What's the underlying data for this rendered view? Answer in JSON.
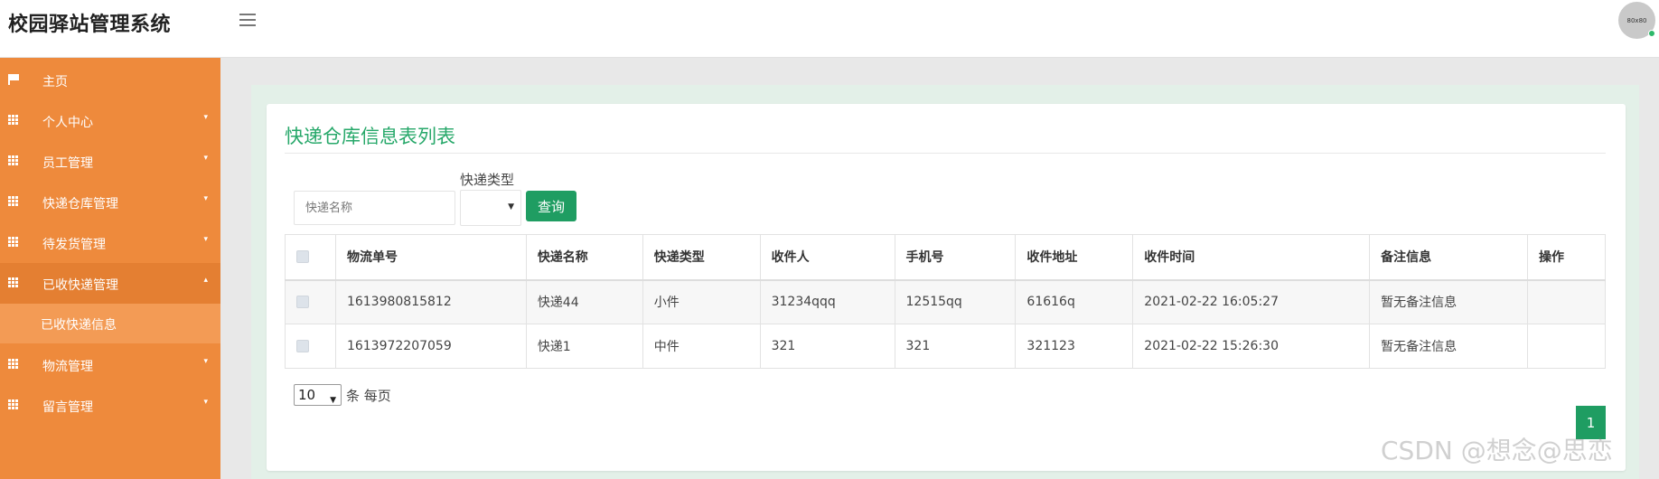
{
  "app": {
    "title": "校园驿站管理系统",
    "avatar_text": "80x80"
  },
  "sidebar": {
    "items": [
      {
        "label": "主页",
        "icon": "flag-icon"
      },
      {
        "label": "个人中心",
        "icon": "grid-icon"
      },
      {
        "label": "员工管理",
        "icon": "grid-icon"
      },
      {
        "label": "快递仓库管理",
        "icon": "grid-icon"
      },
      {
        "label": "待发货管理",
        "icon": "grid-icon"
      },
      {
        "label": "已收快递管理",
        "icon": "grid-icon"
      },
      {
        "label": "物流管理",
        "icon": "grid-icon"
      },
      {
        "label": "留言管理",
        "icon": "grid-icon"
      }
    ],
    "sub_item": "已收快递信息"
  },
  "panel": {
    "title": "快递仓库信息表列表"
  },
  "filters": {
    "name_placeholder": "快递名称",
    "type_label": "快递类型",
    "type_value": "",
    "query_label": "查询"
  },
  "table": {
    "columns": [
      "",
      "物流单号",
      "快递名称",
      "快递类型",
      "收件人",
      "手机号",
      "收件地址",
      "收件时间",
      "备注信息",
      "操作"
    ],
    "rows": [
      [
        "1613980815812",
        "快递44",
        "小件",
        "31234qqq",
        "12515qq",
        "61616q",
        "2021-02-22 16:05:27",
        "暂无备注信息",
        ""
      ],
      [
        "1613972207059",
        "快递1",
        "中件",
        "321",
        "321",
        "321123",
        "2021-02-22 15:26:30",
        "暂无备注信息",
        ""
      ]
    ]
  },
  "pagination": {
    "page_size": "10",
    "per_page_label": "条 每页",
    "current_page": "1"
  },
  "watermark": "CSDN @想念@思恋",
  "colors": {
    "sidebar": "#ee8a3c",
    "accent": "#1f9d62",
    "title": "#27a86a"
  }
}
